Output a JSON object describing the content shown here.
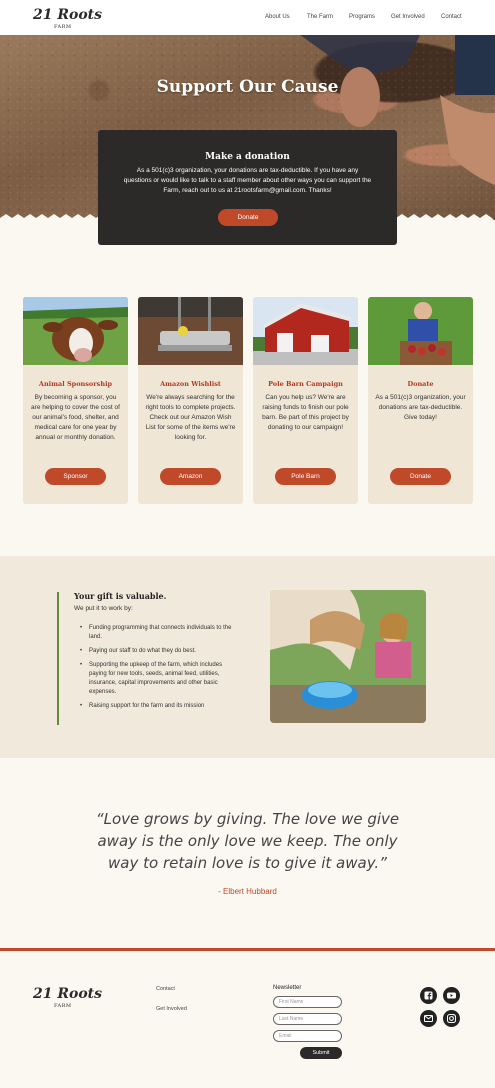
{
  "logo": {
    "main": "21 Roots",
    "sub": "FARM"
  },
  "nav": {
    "items": [
      "About Us",
      "The Farm",
      "Programs",
      "Get Involved",
      "Contact"
    ]
  },
  "hero": {
    "title": "Support Our Cause"
  },
  "donation": {
    "title": "Make a donation",
    "text": "As a 501(c)3 organization, your donations are tax-deductible. If you have any questions or would like to talk to a staff member about other ways you can support the Farm, reach out to us at 21rootsfarm@gmail.com. Thanks!",
    "button": "Donate"
  },
  "cards": [
    {
      "title": "Animal Sponsorship",
      "text": "By becoming a sponsor, you are helping to cover the cost of our animal's food, shelter, and medical care for one year by annual or monthly donation.",
      "button": "Sponsor"
    },
    {
      "title": "Amazon Wishlist",
      "text": "We're always searching for the right tools to complete projects. Check out our Amazon Wish List for some of the items we're looking for.",
      "button": "Amazon"
    },
    {
      "title": "Pole Barn Campaign",
      "text": "Can you help us? We're are raising funds to finish our pole barn. Be part of this project by donating to our campaign!",
      "button": "Pole Barn"
    },
    {
      "title": "Donate",
      "text": "As a 501(c)3 organization, your donations are tax-deductible. Give today!",
      "button": "Donate"
    }
  ],
  "gift": {
    "title": "Your gift is valuable.",
    "subtitle": "We put it to work by:",
    "items": [
      "Funding programming that connects individuals to the land.",
      "Paying our staff to do what they do best.",
      "Supporting the upkeep of the farm, which includes paying for new tools, seeds, animal feed, utilities, insurance, capital improvements and other basic expenses.",
      "Raising support for the farm and its mission"
    ]
  },
  "quote": {
    "text": "“Love grows by giving. The love we give away is the only love we keep. The only way to retain love is to give it away.”",
    "author": "- Elbert Hubbard"
  },
  "footer": {
    "links": [
      "Contact",
      "Get Involved"
    ],
    "newsletter": {
      "title": "Newsletter",
      "first_name": "First Name",
      "last_name": "Last Name",
      "email": "Email",
      "submit": "Submit"
    },
    "social": [
      "facebook-icon",
      "youtube-icon",
      "email-icon",
      "instagram-icon"
    ]
  },
  "colors": {
    "accent": "#c0492a",
    "dark": "#2b2a29",
    "green": "#5e8c3a",
    "card": "#efe6d6"
  }
}
